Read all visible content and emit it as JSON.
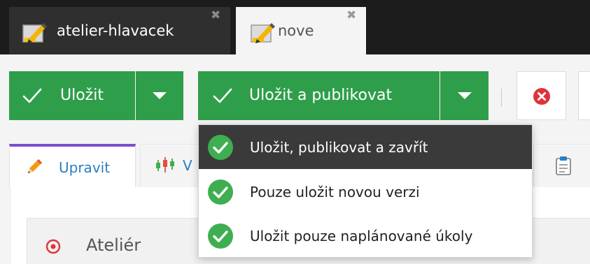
{
  "tabs": [
    {
      "label": "atelier-hlavacek",
      "close": "✖",
      "active": false
    },
    {
      "label": "nove",
      "close": "✖",
      "active": true
    }
  ],
  "toolbar": {
    "save_label": "Uložit",
    "publish_label": "Uložit a publikovat",
    "icons": {
      "check": "check-icon",
      "caret": "caret-down-icon",
      "cancel": "cancel-icon"
    },
    "colors": {
      "primary": "#2f9e4a",
      "cancel": "#e0323a"
    }
  },
  "publish_menu": {
    "items": [
      {
        "label": "Uložit, publikovat a zavřít",
        "highlighted": true
      },
      {
        "label": "Pouze uložit novou verzi",
        "highlighted": false
      },
      {
        "label": "Uložit pouze naplánované úkoly",
        "highlighted": false
      }
    ],
    "icon": "check-circle-icon"
  },
  "content_tabs": {
    "edit_label": "Upravit",
    "stats_label_partial": "V",
    "accent": "#7a4fcf",
    "link_color": "#2a7fc0"
  },
  "section": {
    "title": "Ateliér",
    "icon": "target-icon"
  }
}
